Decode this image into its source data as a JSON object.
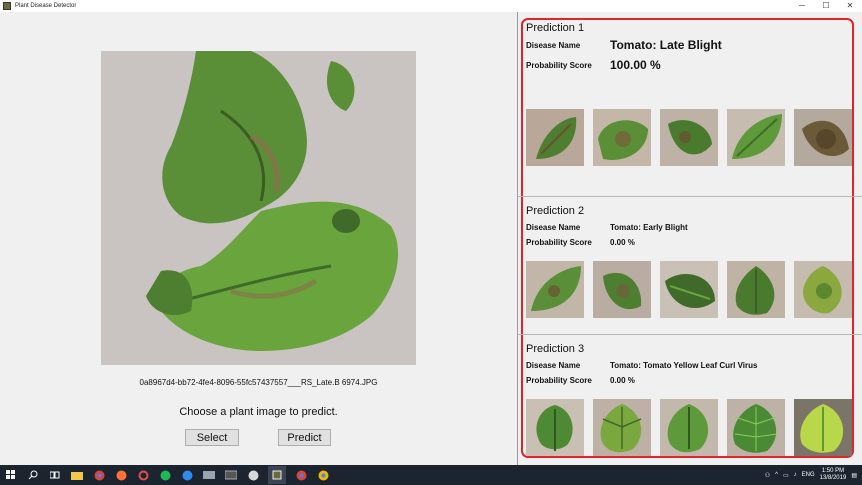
{
  "window": {
    "title": "Plant Disease Detector",
    "icon": "app-icon",
    "controls": [
      "─",
      "☐",
      "✕"
    ]
  },
  "left": {
    "filename": "0a8967d4-bb72-4fe4-8096-55fc57437557___RS_Late.B 6974.JPG",
    "prompt": "Choose a plant image to predict.",
    "select_label": "Select",
    "predict_label": "Predict"
  },
  "predictions": [
    {
      "title": "Prediction 1",
      "disease_label": "Disease Name",
      "disease": "Tomato: Late Blight",
      "prob_label": "Probability Score",
      "prob": "100.00 %"
    },
    {
      "title": "Prediction 2",
      "disease_label": "Disease Name",
      "disease": "Tomato: Early Blight",
      "prob_label": "Probability Score",
      "prob": "0.00 %"
    },
    {
      "title": "Prediction 3",
      "disease_label": "Disease Name",
      "disease": "Tomato: Tomato Yellow Leaf Curl Virus",
      "prob_label": "Probability Score",
      "prob": "0.00 %"
    }
  ],
  "colors": {
    "highlight": "#e0242c",
    "leaf_dark": "#3f6a2a",
    "leaf_light": "#6aa43c",
    "taskbar": "#1c2430"
  },
  "taskbar": {
    "items": [
      "windows-icon",
      "search-icon",
      "task-view-icon",
      "file-explorer-icon",
      "chrome-icon",
      "firefox-icon",
      "settings-icon",
      "spotify-icon",
      "app-icon",
      "explorer-icon",
      "terminal-icon",
      "python-icon",
      "plant-app-icon",
      "chrome-icon",
      "chrome-icon"
    ],
    "lang": "ENG",
    "time": "1:50 PM",
    "date": "13/8/2019"
  }
}
